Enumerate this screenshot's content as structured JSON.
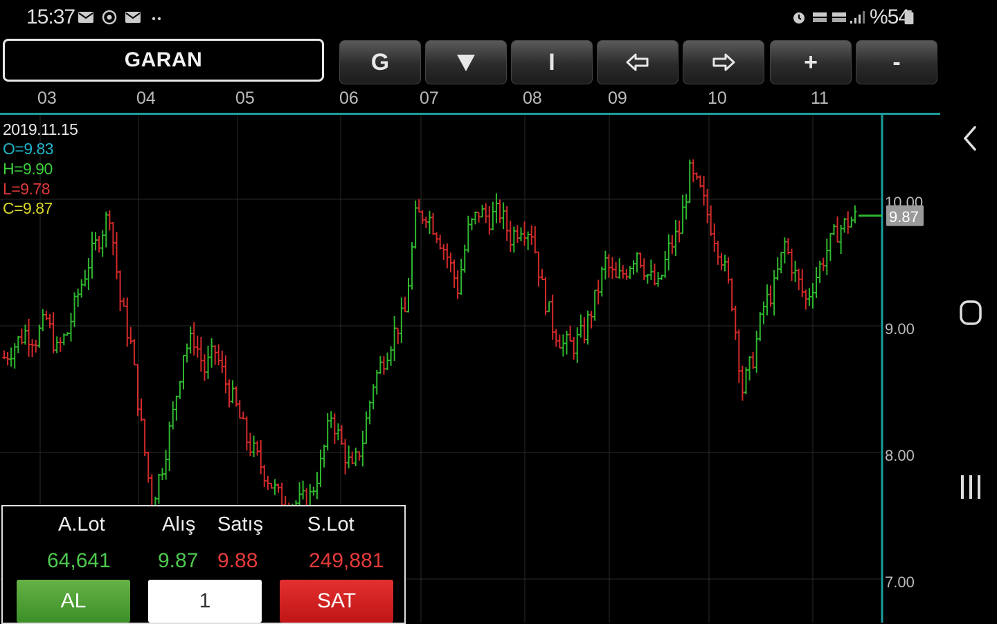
{
  "status_bar": {
    "time": "15:37",
    "left_icons": [
      "mail-icon",
      "whatsapp-icon",
      "gmail-icon",
      "more-dots-icon"
    ],
    "right_icons": [
      "alarm-icon",
      "volte-icon",
      "data-4g-icon",
      "signal-icon"
    ],
    "battery": "%54"
  },
  "toolbar": {
    "symbol": "GARAN",
    "buttons": [
      {
        "name": "period-g-button",
        "label": "G"
      },
      {
        "name": "chart-type-button",
        "label": "▼"
      },
      {
        "name": "indicator-button",
        "label": "I"
      },
      {
        "name": "scroll-left-button",
        "label": "⇦"
      },
      {
        "name": "scroll-right-button",
        "label": "⇨"
      },
      {
        "name": "zoom-in-button",
        "label": "+"
      },
      {
        "name": "zoom-out-button",
        "label": "-"
      }
    ]
  },
  "colors": {
    "up": "#2fb82f",
    "down": "#d42a2a",
    "accent_teal": "#1e9d9d",
    "open": "#1fb5c8",
    "high": "#3dd13d",
    "low": "#e03a3a",
    "close": "#d8d82a",
    "grid": "#2a2a2a"
  },
  "ohlc_info": {
    "date": "2019.11.15",
    "open": "O=9.83",
    "high": "H=9.90",
    "low": "L=9.78",
    "close": "C=9.87"
  },
  "chart_data": {
    "type": "ohlc",
    "x_tick_labels": [
      "03",
      "04",
      "05",
      "06",
      "07",
      "08",
      "09",
      "10",
      "11"
    ],
    "y_tick_labels": [
      "10.00",
      "9.00",
      "8.00",
      "7.00"
    ],
    "ylim": [
      6.7,
      10.7
    ],
    "current_price": "9.87",
    "close_series": [
      8.75,
      8.85,
      8.95,
      8.9,
      9.05,
      8.8,
      8.95,
      9.25,
      9.5,
      9.7,
      9.9,
      9.2,
      8.85,
      8.2,
      7.6,
      7.9,
      8.3,
      8.8,
      8.9,
      8.65,
      8.8,
      8.55,
      8.35,
      8.1,
      7.95,
      7.8,
      7.65,
      7.6,
      7.6,
      7.65,
      7.9,
      8.3,
      8.05,
      7.85,
      8.1,
      8.55,
      8.75,
      8.95,
      9.1,
      9.85,
      9.9,
      9.75,
      9.55,
      9.3,
      9.75,
      9.9,
      9.85,
      9.9,
      9.7,
      9.8,
      9.75,
      9.3,
      9.0,
      8.85,
      8.85,
      8.95,
      9.2,
      9.5,
      9.35,
      9.45,
      9.6,
      9.4,
      9.3,
      9.6,
      9.75,
      10.2,
      10.05,
      9.8,
      9.55,
      9.2,
      8.5,
      8.75,
      9.15,
      9.3,
      9.65,
      9.4,
      9.2,
      9.4,
      9.6,
      9.75,
      9.82,
      9.87
    ]
  },
  "order_panel": {
    "headers": {
      "buy_lot": "A.Lot",
      "bid": "Alış",
      "ask": "Satış",
      "sell_lot": "S.Lot"
    },
    "values": {
      "buy_lot": "64,641",
      "bid": "9.87",
      "ask": "9.88",
      "sell_lot": "249,881"
    },
    "buy_label": "AL",
    "sell_label": "SAT",
    "quantity": "1"
  },
  "nav": [
    "back-icon",
    "home-icon",
    "recents-icon"
  ]
}
